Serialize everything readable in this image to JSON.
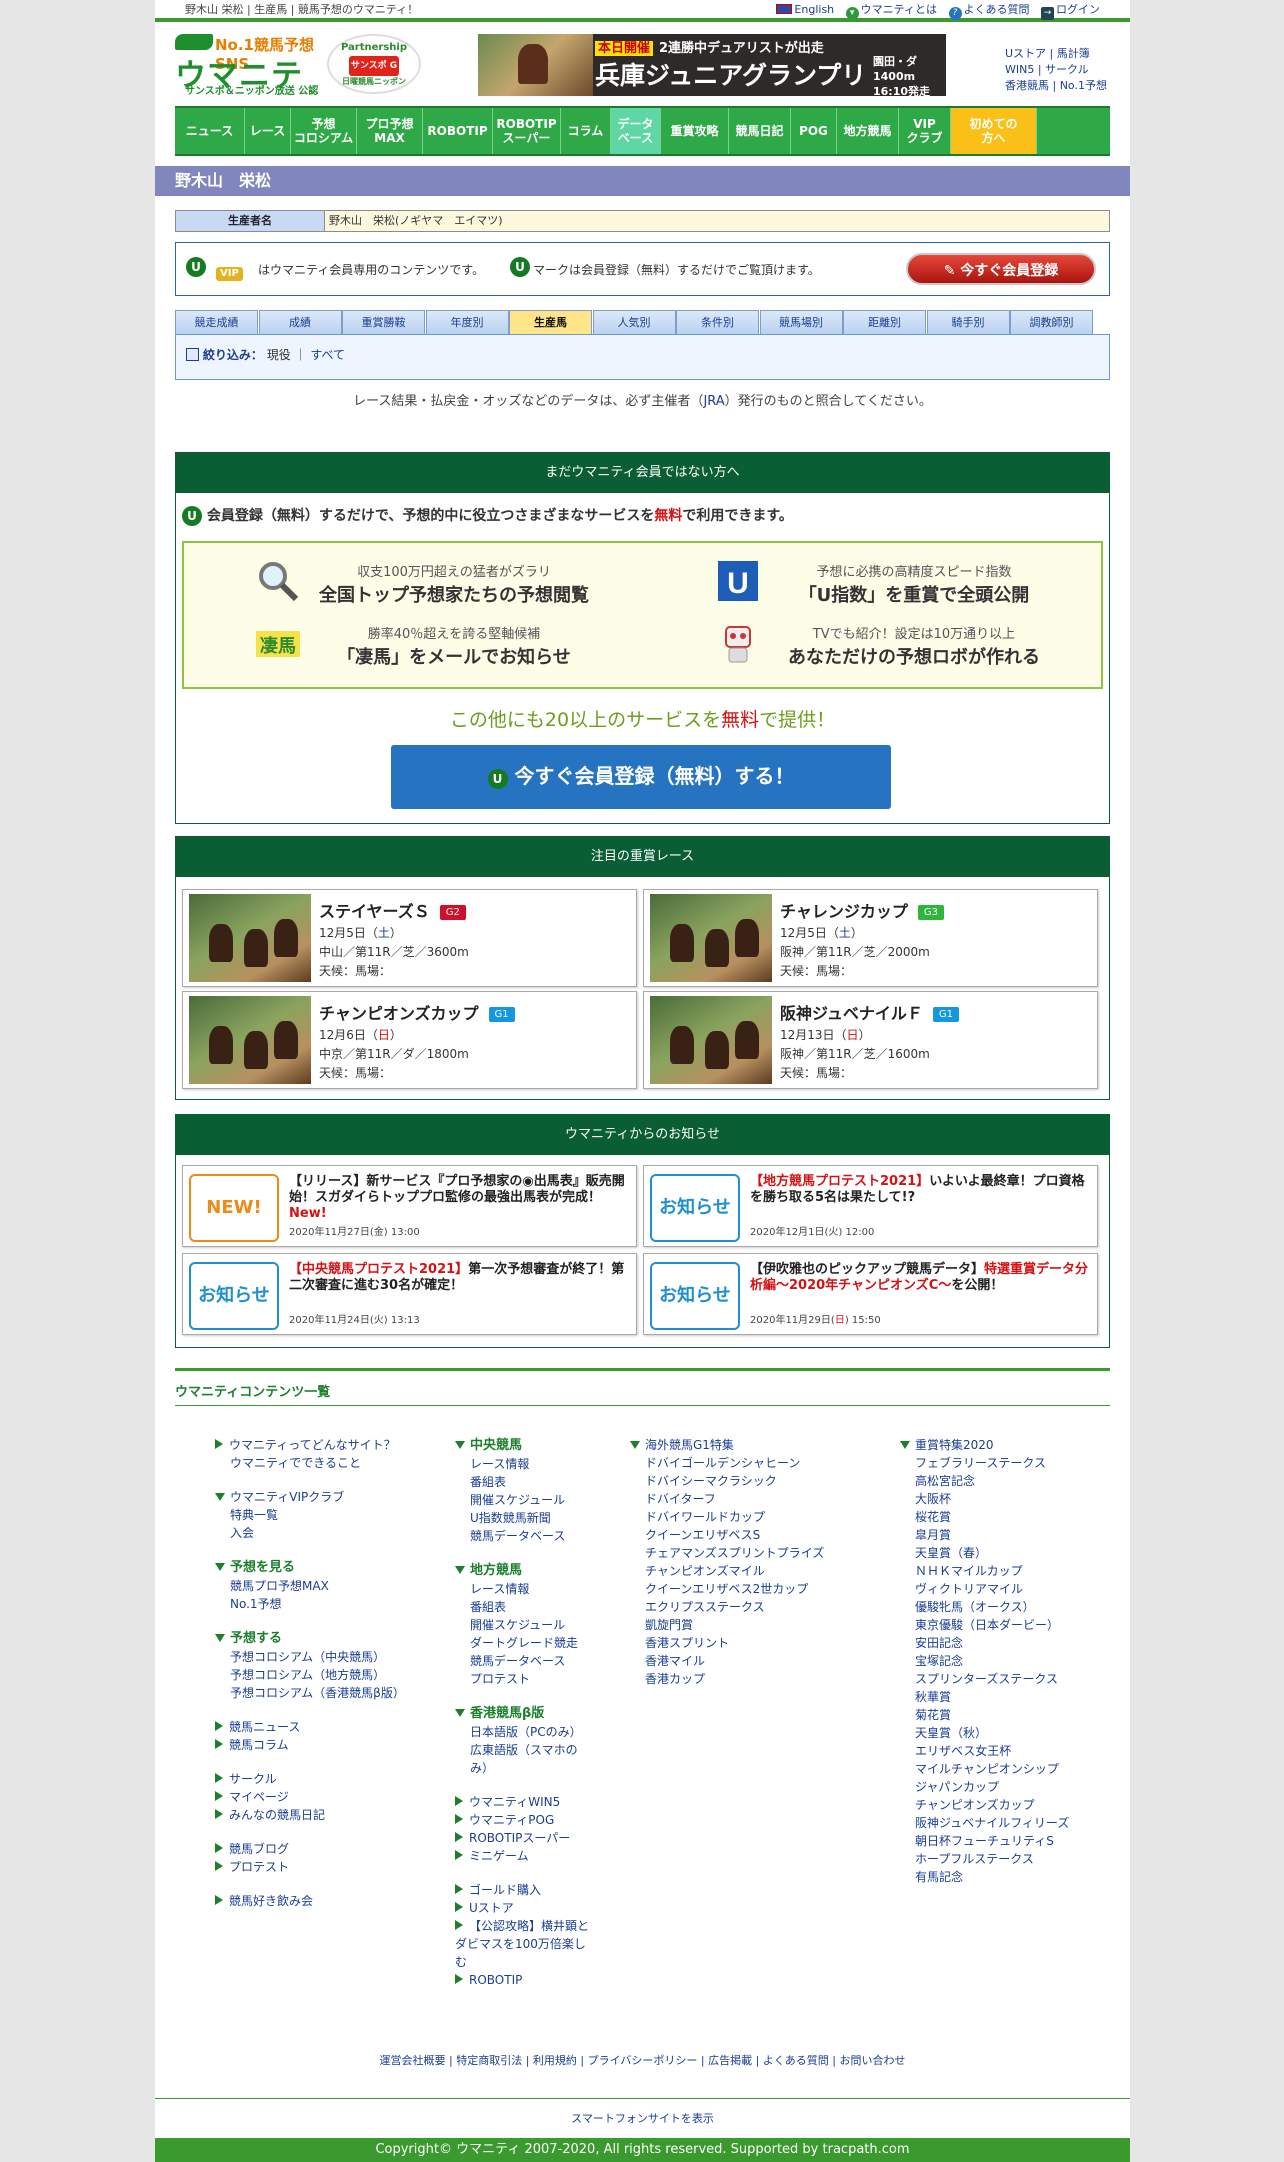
{
  "header": {
    "tagline": "野木山 栄松 | 生産馬 | 競馬予想のウマニティ！",
    "links": [
      "English",
      "ウマニティとは",
      "よくある質問",
      "ログイン"
    ],
    "logo_top": "No.1競馬予想SNS",
    "logo_main": "ウマニティ",
    "logo_sub": "サンスポ＆ニッポン放送 公認",
    "partner_label": "Partnership",
    "partner_sub": "サンスポ G",
    "partner_bottom": "日曜競馬ニッポン",
    "banner": {
      "tag": "本日開催",
      "headline": "2連勝中デュアリストが出走",
      "race": "兵庫ジュニアグランプリ",
      "info1": "園田・ダ1400m",
      "info2": "16:10発走"
    },
    "side_links": [
      "Uストア",
      "馬計簿",
      "WIN5",
      "サークル",
      "香港競馬",
      "No.1予想"
    ]
  },
  "nav": [
    {
      "label": "ニュース"
    },
    {
      "label": "レース"
    },
    {
      "label": "予想\nコロシアム"
    },
    {
      "label": "プロ予想\nMAX"
    },
    {
      "label": "ROBOTIP"
    },
    {
      "label": "ROBOTIP\nスーパー"
    },
    {
      "label": "コラム"
    },
    {
      "label": "データ\nベース"
    },
    {
      "label": "重賞攻略"
    },
    {
      "label": "競馬日記"
    },
    {
      "label": "POG"
    },
    {
      "label": "地方競馬"
    },
    {
      "label": "VIP\nクラブ"
    },
    {
      "label": "初めての\n方へ"
    }
  ],
  "page_title": "野木山　栄松",
  "producer": {
    "label": "生産者名",
    "value": "野木山　栄松(ノギヤマ　エイマツ)"
  },
  "member_notice": {
    "badge_u": "U",
    "badge_vip": "VIP",
    "text1": "はウマニティ会員専用のコンテンツです。",
    "text2": "マークは会員登録（無料）するだけでご覧頂けます。",
    "button": "今すぐ会員登録"
  },
  "tabs": [
    "競走成績",
    "成績",
    "重賞勝鞍",
    "年度別",
    "生産馬",
    "人気別",
    "条件別",
    "競馬場別",
    "距離別",
    "騎手別",
    "調教師別"
  ],
  "active_tab": "生産馬",
  "filter": {
    "label": "絞り込み",
    "colon": "：",
    "opt1": "現役",
    "sep": "｜",
    "opt2": "すべて"
  },
  "disclaimer": {
    "pre": "レース結果・払戻金・オッズなどのデータは、必ず主催者（",
    "link": "JRA",
    "post": "）発行のものと照合してください。"
  },
  "promo": {
    "header": "まだウマニティ会員ではない方へ",
    "lead_pre": "会員登録（無料）するだけで、予想的中に役立つさまざまなサービスを",
    "lead_red": "無料",
    "lead_post": "で利用できます。",
    "features": [
      {
        "small": "収支100万円超えの猛者がズラリ",
        "big": "全国トップ予想家たちの予想閲覧",
        "icon": "magnifier-icon"
      },
      {
        "small": "予想に必携の高精度スピード指数",
        "big": "「U指数」を重賞で全頭公開",
        "icon": "u-index-icon"
      },
      {
        "small": "勝率40％超えを誇る堅軸候補",
        "big": "「凄馬」をメールでお知らせ",
        "icon": "sugouma-icon"
      },
      {
        "small": "TVでも紹介！設定は10万通り以上",
        "big": "あなただけの予想ロボが作れる",
        "icon": "robot-icon"
      }
    ],
    "more_pre": "この他にも20以上のサービスを",
    "more_red": "無料",
    "more_post": "で提供！",
    "button": "今すぐ会員登録（無料）する！"
  },
  "races_panel": {
    "header": "注目の重賞レース",
    "races": [
      {
        "name": "ステイヤーズＳ",
        "grade": "G2",
        "grade_color": "#d0102a",
        "date": "12月5日（",
        "dow": "土",
        "dow_class": "sat",
        "date_end": "）",
        "course": "中山／第11R／芝／3600m",
        "cond": "天候：馬場："
      },
      {
        "name": "チャレンジカップ",
        "grade": "G3",
        "grade_color": "#2eb63c",
        "date": "12月5日（",
        "dow": "土",
        "dow_class": "sat",
        "date_end": "）",
        "course": "阪神／第11R／芝／2000m",
        "cond": "天候：馬場："
      },
      {
        "name": "チャンピオンズカップ",
        "grade": "G1",
        "grade_color": "#1597e0",
        "date": "12月6日（",
        "dow": "日",
        "dow_class": "sun",
        "date_end": "）",
        "course": "中京／第11R／ダ／1800m",
        "cond": "天候：馬場："
      },
      {
        "name": "阪神ジュベナイルＦ",
        "grade": "G1",
        "grade_color": "#1597e0",
        "date": "12月13日（",
        "dow": "日",
        "dow_class": "sun",
        "date_end": "）",
        "course": "阪神／第11R／芝／1600m",
        "cond": "天候：馬場："
      }
    ]
  },
  "news_panel": {
    "header": "ウマニティからのお知らせ",
    "items": [
      {
        "icon_label": "NEW!",
        "icon_color": "#f08a14",
        "red": "",
        "title": "【リリース】新サービス『プロ予想家の◉出馬表』販売開始！スガダイらトッププロ監修の最強出馬表が完成！",
        "tail_red": "New!",
        "date": "2020年11月27日(金) 13:00"
      },
      {
        "icon_label": "お知らせ",
        "icon_color": "#1e8fd1",
        "red": "【地方競馬プロテスト2021】",
        "title": "いよいよ最終章！プロ資格を勝ち取る5名は果たして!?",
        "tail_red": "",
        "date": "2020年12月1日(火) 12:00"
      },
      {
        "icon_label": "お知らせ",
        "icon_color": "#1e8fd1",
        "red": "【中央競馬プロテスト2021】",
        "title": "第一次予想審査が終了！第二次審査に進む30名が確定！",
        "tail_red": "",
        "date": "2020年11月24日(火) 13:13"
      },
      {
        "icon_label": "お知らせ",
        "icon_color": "#1e8fd1",
        "red": "",
        "title": "【伊吹雅也のピックアップ競馬データ】",
        "tail_red": "特選重賞データ分析編～2020年チャンピオンズC～",
        "tail": "を公開！",
        "date": "2020年11月29日(",
        "date_red": "日",
        "date_end": ") 15:50"
      }
    ]
  },
  "contents": {
    "title": "ウマニティコンテンツ一覧",
    "col1": [
      {
        "type": "link",
        "text": "ウマニティってどんなサイト？"
      },
      {
        "type": "sub",
        "text": "ウマニティでできること"
      },
      {
        "type": "gap"
      },
      {
        "type": "link",
        "text": "ウマニティVIPクラブ",
        "tri": true
      },
      {
        "type": "sub",
        "text": "特典一覧"
      },
      {
        "type": "sub",
        "text": "入会"
      },
      {
        "type": "gap"
      },
      {
        "type": "head",
        "text": "予想を見る"
      },
      {
        "type": "sub",
        "text": "競馬プロ予想MAX"
      },
      {
        "type": "sub",
        "text": "No.1予想"
      },
      {
        "type": "gap"
      },
      {
        "type": "head",
        "text": "予想する"
      },
      {
        "type": "sub",
        "text": "予想コロシアム（中央競馬）"
      },
      {
        "type": "sub",
        "text": "予想コロシアム（地方競馬）"
      },
      {
        "type": "sub",
        "text": "予想コロシアム（香港競馬β版）"
      },
      {
        "type": "gap"
      },
      {
        "type": "link",
        "text": "競馬ニュース"
      },
      {
        "type": "link",
        "text": "競馬コラム"
      },
      {
        "type": "gap"
      },
      {
        "type": "link",
        "text": "サークル"
      },
      {
        "type": "link",
        "text": "マイページ"
      },
      {
        "type": "link",
        "text": "みんなの競馬日記"
      },
      {
        "type": "gap"
      },
      {
        "type": "link",
        "text": "競馬ブログ"
      },
      {
        "type": "link",
        "text": "プロテスト"
      },
      {
        "type": "gap"
      },
      {
        "type": "link",
        "text": "競馬好き飲み会"
      }
    ],
    "col2": [
      {
        "type": "head",
        "text": "中央競馬"
      },
      {
        "type": "sub",
        "text": "レース情報"
      },
      {
        "type": "sub",
        "text": "番組表"
      },
      {
        "type": "sub",
        "text": "開催スケジュール"
      },
      {
        "type": "sub",
        "text": "U指数競馬新聞"
      },
      {
        "type": "sub",
        "text": "競馬データベース"
      },
      {
        "type": "gap"
      },
      {
        "type": "head",
        "text": "地方競馬"
      },
      {
        "type": "sub",
        "text": "レース情報"
      },
      {
        "type": "sub",
        "text": "番組表"
      },
      {
        "type": "sub",
        "text": "開催スケジュール"
      },
      {
        "type": "sub",
        "text": "ダートグレード競走"
      },
      {
        "type": "sub",
        "text": "競馬データベース"
      },
      {
        "type": "sub",
        "text": "プロテスト"
      },
      {
        "type": "gap"
      },
      {
        "type": "head",
        "text": "香港競馬β版"
      },
      {
        "type": "sub",
        "text": "日本語版（PCのみ）"
      },
      {
        "type": "sub",
        "text": "広東語版（スマホのみ）"
      },
      {
        "type": "gap"
      },
      {
        "type": "link",
        "text": "ウマニティWIN5"
      },
      {
        "type": "link",
        "text": "ウマニティPOG"
      },
      {
        "type": "link",
        "text": "ROBOTIPスーパー"
      },
      {
        "type": "link",
        "text": "ミニゲーム"
      },
      {
        "type": "gap"
      },
      {
        "type": "link",
        "text": "ゴールド購入"
      },
      {
        "type": "link",
        "text": "Uストア"
      },
      {
        "type": "link",
        "text": "【公認攻略】横井顕とダビマスを100万倍楽しむ"
      },
      {
        "type": "link",
        "text": "ROBOTIP"
      }
    ],
    "col3": [
      {
        "type": "link",
        "text": "海外競馬G1特集",
        "tri": true
      },
      {
        "type": "sub",
        "text": "ドバイゴールデンシャヒーン"
      },
      {
        "type": "sub",
        "text": "ドバイシーマクラシック"
      },
      {
        "type": "sub",
        "text": "ドバイターフ"
      },
      {
        "type": "sub",
        "text": "ドバイワールドカップ"
      },
      {
        "type": "sub",
        "text": "クイーンエリザベスS"
      },
      {
        "type": "sub",
        "text": "チェアマンズスプリントプライズ"
      },
      {
        "type": "sub",
        "text": "チャンピオンズマイル"
      },
      {
        "type": "sub",
        "text": "クイーンエリザベス2世カップ"
      },
      {
        "type": "sub",
        "text": "エクリプスステークス"
      },
      {
        "type": "sub",
        "text": "凱旋門賞"
      },
      {
        "type": "sub",
        "text": "香港スプリント"
      },
      {
        "type": "sub",
        "text": "香港マイル"
      },
      {
        "type": "sub",
        "text": "香港カップ"
      }
    ],
    "col4": [
      {
        "type": "link",
        "text": "重賞特集2020",
        "tri": true
      },
      {
        "type": "sub",
        "text": "フェブラリーステークス"
      },
      {
        "type": "sub",
        "text": "高松宮記念"
      },
      {
        "type": "sub",
        "text": "大阪杯"
      },
      {
        "type": "sub",
        "text": "桜花賞"
      },
      {
        "type": "sub",
        "text": "皐月賞"
      },
      {
        "type": "sub",
        "text": "天皇賞（春）"
      },
      {
        "type": "sub",
        "text": "ＮＨＫマイルカップ"
      },
      {
        "type": "sub",
        "text": "ヴィクトリアマイル"
      },
      {
        "type": "sub",
        "text": "優駿牝馬（オークス）"
      },
      {
        "type": "sub",
        "text": "東京優駿（日本ダービー）"
      },
      {
        "type": "sub",
        "text": "安田記念"
      },
      {
        "type": "sub",
        "text": "宝塚記念"
      },
      {
        "type": "sub",
        "text": "スプリンターズステークス"
      },
      {
        "type": "sub",
        "text": "秋華賞"
      },
      {
        "type": "sub",
        "text": "菊花賞"
      },
      {
        "type": "sub",
        "text": "天皇賞（秋）"
      },
      {
        "type": "sub",
        "text": "エリザベス女王杯"
      },
      {
        "type": "sub",
        "text": "マイルチャンピオンシップ"
      },
      {
        "type": "sub",
        "text": "ジャパンカップ"
      },
      {
        "type": "sub",
        "text": "チャンピオンズカップ"
      },
      {
        "type": "sub",
        "text": "阪神ジュベナイルフィリーズ"
      },
      {
        "type": "sub",
        "text": "朝日杯フューチュリティS"
      },
      {
        "type": "sub",
        "text": "ホープフルステークス"
      },
      {
        "type": "sub",
        "text": "有馬記念"
      }
    ]
  },
  "footer": {
    "links": "運営会社概要 | 特定商取引法 | 利用規約 | プライバシーポリシー | 広告掲載 | よくある質問 | お問い合わせ",
    "sp": "スマートフォンサイトを表示",
    "copyright": "Copyright© ウマニティ 2007-2020, All rights reserved. Supported by tracpath.com"
  }
}
